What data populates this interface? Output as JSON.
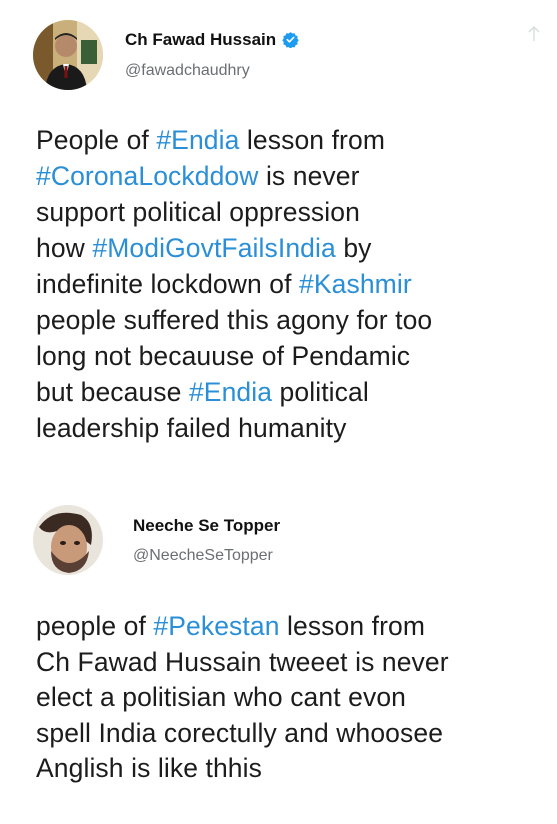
{
  "tweet1": {
    "name": "Ch Fawad Hussain",
    "handle": "@fawadchaudhry",
    "verified": true,
    "lines": [
      [
        {
          "t": "People of "
        },
        {
          "t": "#Endia",
          "tag": true
        },
        {
          "t": " lesson from"
        }
      ],
      [
        {
          "t": "#CoronaLockddow",
          "tag": true
        },
        {
          "t": " is never"
        }
      ],
      [
        {
          "t": "support political oppression"
        }
      ],
      [
        {
          "t": "how "
        },
        {
          "t": "#ModiGovtFailsIndia",
          "tag": true
        },
        {
          "t": " by"
        }
      ],
      [
        {
          "t": "indefinite lockdown of "
        },
        {
          "t": "#Kashmir",
          "tag": true
        }
      ],
      [
        {
          "t": "people suffered this agony for too"
        }
      ],
      [
        {
          "t": "long not becauuse of Pendamic"
        }
      ],
      [
        {
          "t": "but because "
        },
        {
          "t": "#Endia",
          "tag": true
        },
        {
          "t": " political"
        }
      ],
      [
        {
          "t": "leadership failed humanity"
        }
      ]
    ]
  },
  "tweet2": {
    "name": "Neeche Se Topper",
    "handle": "@NeecheSeTopper",
    "lines": [
      [
        {
          "t": "people of "
        },
        {
          "t": "#Pekestan",
          "tag": true
        },
        {
          "t": " lesson from"
        }
      ],
      [
        {
          "t": "Ch Fawad Hussain tweeet is never"
        }
      ],
      [
        {
          "t": "elect a politisian who cant evon"
        }
      ],
      [
        {
          "t": "spell India corectully and whoosee"
        }
      ],
      [
        {
          "t": "Anglish is like thhis"
        }
      ]
    ]
  },
  "colors": {
    "hashtag": "#2a8fd6",
    "verified_badge": "#1d9bf0",
    "handle": "#6b6f73"
  },
  "icons": {
    "verified": "verified-badge-icon",
    "share": "share-icon"
  }
}
